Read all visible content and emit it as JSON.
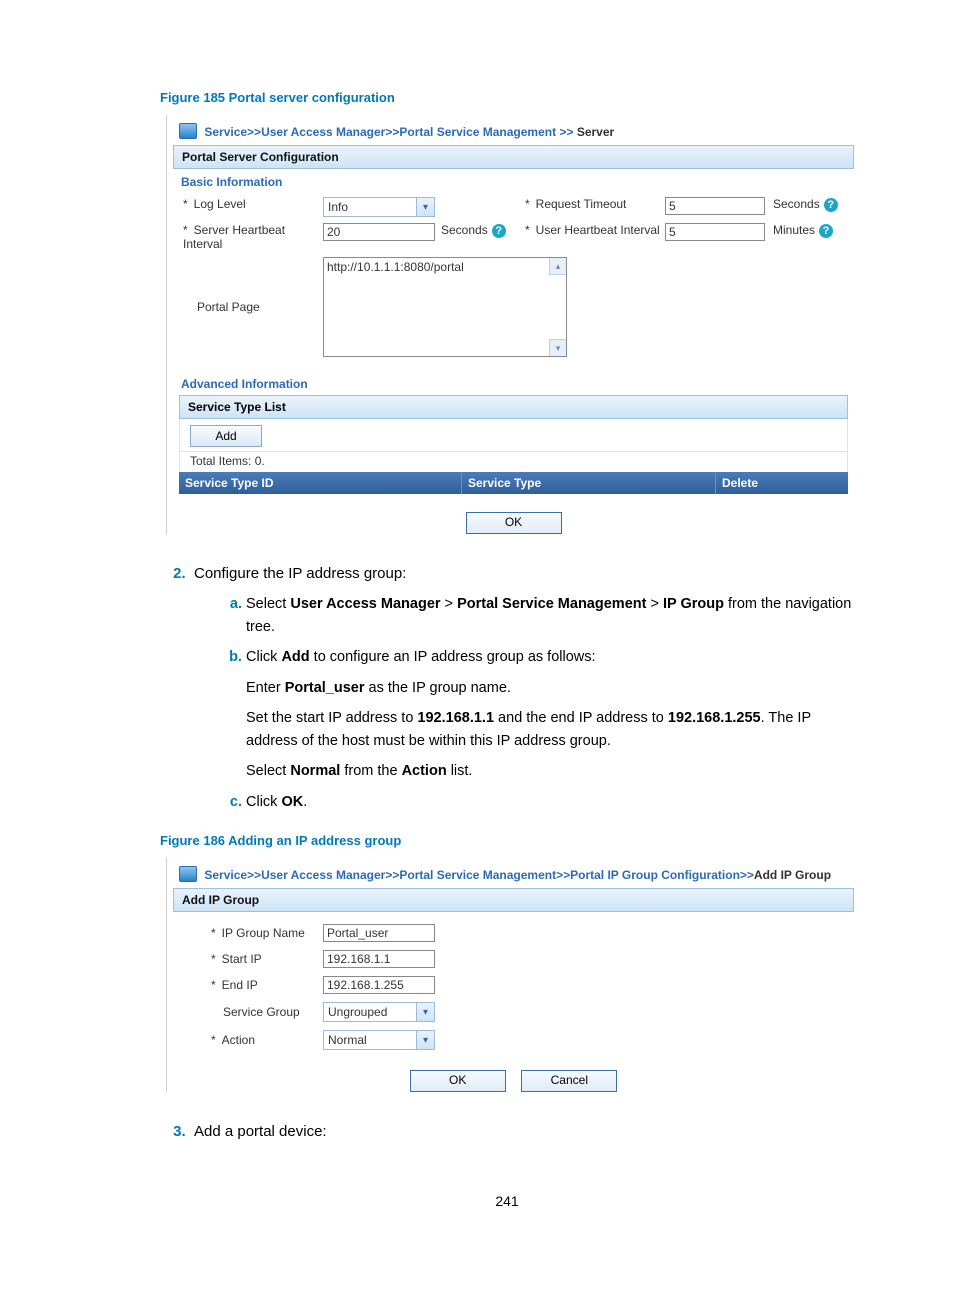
{
  "fig185_caption": "Figure 185 Portal server configuration",
  "panel1": {
    "breadcrumb": {
      "service": "Service",
      "uam": "User Access Manager",
      "psm": "Portal Service Management",
      "server": "Server"
    },
    "section_title": "Portal Server Configuration",
    "basic_heading": "Basic Information",
    "labels": {
      "log_level": "Log Level",
      "shi": "Server Heartbeat Interval",
      "portal_page": "Portal Page",
      "request_timeout": "Request Timeout",
      "uhi": "User Heartbeat Interval",
      "seconds": "Seconds",
      "minutes": "Minutes"
    },
    "values": {
      "log_level": "Info",
      "shi": "20",
      "portal_page": "http://10.1.1.1:8080/portal",
      "request_timeout": "5",
      "uhi": "5"
    },
    "advanced_heading": "Advanced Information",
    "svc_list_title": "Service Type List",
    "add_label": "Add",
    "total_items": "Total Items: 0.",
    "col_id": "Service Type ID",
    "col_type": "Service Type",
    "col_delete": "Delete",
    "ok": "OK"
  },
  "step2": {
    "title": "Configure the IP address group:",
    "a_prefix": "Select ",
    "a_b1": "User Access Manager",
    "a_mid1": " > ",
    "a_b2": "Portal Service Management",
    "a_mid2": " > ",
    "a_b3": "IP Group",
    "a_suffix": " from the navigation tree.",
    "b_prefix": "Click ",
    "b_bold": "Add",
    "b_suffix": " to configure an IP address group as follows:",
    "p1_prefix": "Enter ",
    "p1_bold": "Portal_user",
    "p1_suffix": " as the IP group name.",
    "p2_1": "Set the start IP address to ",
    "p2_b1": "192.168.1.1",
    "p2_2": " and the end IP address to ",
    "p2_b2": "192.168.1.255",
    "p2_3": ". The IP address of the host must be within this IP address group.",
    "p3_1": "Select ",
    "p3_b1": "Normal",
    "p3_2": " from the ",
    "p3_b2": "Action",
    "p3_3": " list.",
    "c_prefix": "Click ",
    "c_bold": "OK",
    "c_suffix": "."
  },
  "fig186_caption": "Figure 186 Adding an IP address group",
  "panel2": {
    "breadcrumb": {
      "service": "Service",
      "uam": "User Access Manager",
      "psm": "Portal Service Management",
      "pigc": "Portal IP Group Configuration",
      "add": "Add IP Group"
    },
    "section_title": "Add IP Group",
    "labels": {
      "ip_group_name": "IP Group Name",
      "start_ip": "Start IP",
      "end_ip": "End IP",
      "service_group": "Service Group",
      "action": "Action"
    },
    "values": {
      "ip_group_name": "Portal_user",
      "start_ip": "192.168.1.1",
      "end_ip": "192.168.1.255",
      "service_group": "Ungrouped",
      "action": "Normal"
    },
    "ok": "OK",
    "cancel": "Cancel"
  },
  "step3": "Add a portal device:",
  "page_number": "241"
}
